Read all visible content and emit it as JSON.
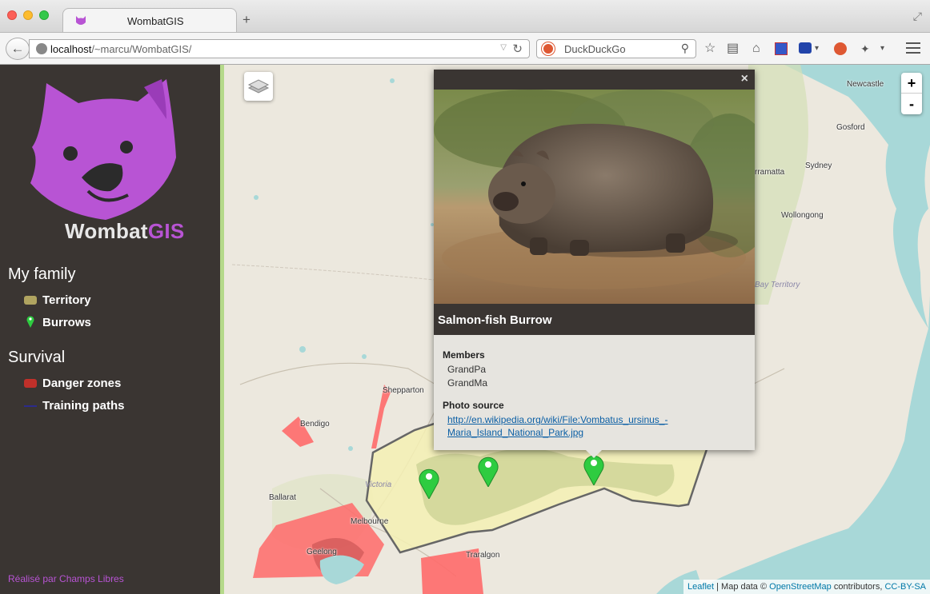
{
  "browser": {
    "tab_title": "WombatGIS",
    "new_tab": "+",
    "url_host": "localhost",
    "url_path": "/~marcu/WombatGIS/",
    "search_placeholder": "DuckDuckGo"
  },
  "sidebar": {
    "logo_text_main": "Wombat",
    "logo_text_accent": "GIS",
    "sections": [
      {
        "title": "My family",
        "items": [
          {
            "label": "Territory",
            "color": "#b0a460"
          },
          {
            "label": "Burrows",
            "color": "#2ecc40"
          }
        ]
      },
      {
        "title": "Survival",
        "items": [
          {
            "label": "Danger zones",
            "color": "#c0302a"
          },
          {
            "label": "Training paths",
            "color": "#2b2b8c"
          }
        ]
      }
    ],
    "credit": "Réalisé par Champs Libres",
    "accent_color": "#b854d4"
  },
  "map": {
    "places": {
      "newcastle": "Newcastle",
      "gosford": "Gosford",
      "sydney": "Sydney",
      "parramatta": "rramatta",
      "wollongong": "Wollongong",
      "bay_territory": "Bay Territory",
      "shepparton": "Shepparton",
      "bendigo": "Bendigo",
      "victoria": "Victoria",
      "ballarat": "Ballarat",
      "melbourne": "Melbourne",
      "geelong": "Geelong",
      "traralgon": "Traralgon"
    },
    "zoom_in": "+",
    "zoom_out": "-",
    "attribution": {
      "leaflet": "Leaflet",
      "sep": " | Map data © ",
      "osm": "OpenStreetMap",
      "contrib": " contributors, ",
      "license": "CC-BY-SA"
    }
  },
  "popup": {
    "close": "×",
    "title": "Salmon-fish Burrow",
    "members_label": "Members",
    "members": [
      "GrandPa",
      "GrandMa"
    ],
    "photo_source_label": "Photo source",
    "photo_link": "http://en.wikipedia.org/wiki/File:Vombatus_ursinus_-Maria_Island_National_Park.jpg",
    "photo_link_line1": "http://en.wikipedia.org/wiki/File:Vombatus_ursinus_-",
    "photo_link_line2": "Maria_Island_National_Park.jpg"
  }
}
